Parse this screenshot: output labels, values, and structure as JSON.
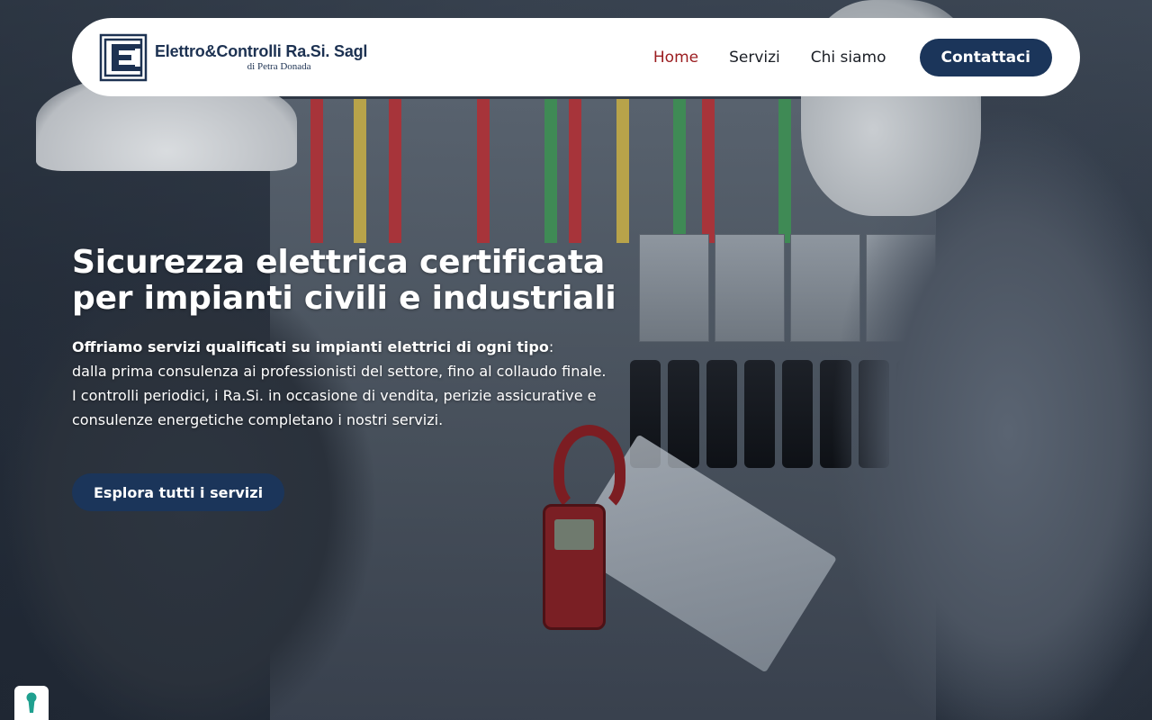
{
  "header": {
    "brand_name": "Elettro&Controlli Ra.Si. Sagl",
    "brand_sub": "di Petra Donada",
    "nav": [
      {
        "label": "Home",
        "active": true
      },
      {
        "label": "Servizi",
        "active": false
      },
      {
        "label": "Chi siamo",
        "active": false
      }
    ],
    "cta_label": "Contattaci"
  },
  "hero": {
    "title": "Sicurezza elettrica certificata per impianti civili e industriali",
    "lead_strong": "Offriamo servizi qualificati su impianti elettrici di ogni tipo",
    "lead_colon": ":",
    "line1": "dalla prima consulenza ai professionisti del settore, fino al collaudo finale.",
    "line2": "I controlli periodici, i Ra.Si. in occasione di vendita, perizie  assicurative e consulenze  energetiche completano i nostri servizi.",
    "button_label": "Esplora tutti i servizi"
  },
  "icons": {
    "logo": "ec-logo-icon",
    "privacy": "keyhole-icon"
  },
  "colors": {
    "brand_navy": "#1b355a",
    "active_nav": "#9b1c1f",
    "privacy_teal": "#1fa08f"
  }
}
